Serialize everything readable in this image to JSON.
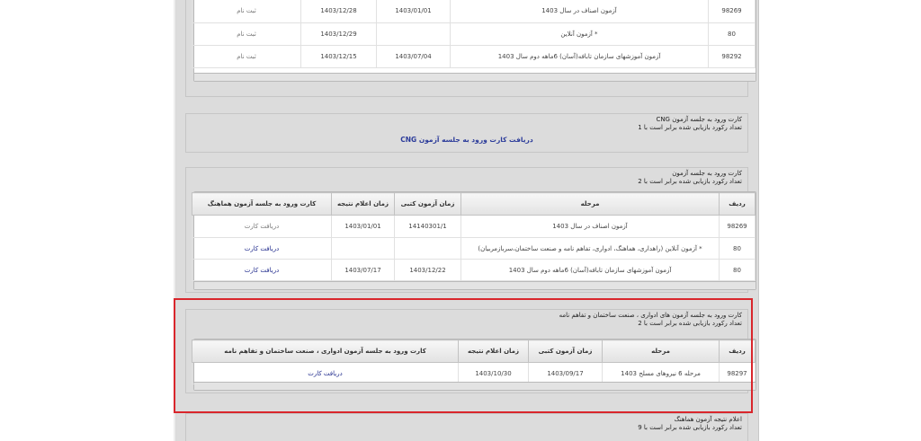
{
  "top_table": {
    "rows": [
      {
        "id": "98269",
        "stage": "آزمون اصناف در سال 1403",
        "exam": "1403/01/01",
        "result": "1403/12/28",
        "card": "ثبت نام"
      },
      {
        "id": "80",
        "stage": "* آزمون آنلاین",
        "exam": "",
        "result": "1403/12/29",
        "card": "ثبت نام"
      },
      {
        "id": "98292",
        "stage": "آزمون آموزشهای سازمان تابافه(آسان) 6ماهه دوم سال 1403",
        "exam": "1403/07/04",
        "result": "1403/12/15",
        "card": "ثبت نام"
      }
    ]
  },
  "cng": {
    "title": "کارت ورود به جلسه آزمون CNG",
    "count": "تعداد رکورد بازیابی شده برابر است با 1",
    "link": "دریافت کارت ورود به جلسه آزمون CNG"
  },
  "hamahang": {
    "title": "کارت ورود به جلسه آزمون",
    "count": "تعداد رکورد بازیابی شده برابر است با 2",
    "headers": {
      "id": "ردیف",
      "stage": "مرحله",
      "exam": "زمان آزمون کتبی",
      "result": "زمان اعلام نتیجه",
      "card": "کارت ورود به جلسه آزمون هماهنگ"
    },
    "rows": [
      {
        "id": "98269",
        "stage": "آزمون اصناف در سال 1403",
        "exam": "14140301/1",
        "result": "1403/01/01",
        "card": "دریافت کارت"
      },
      {
        "id": "80",
        "stage": "* آزمون آنلاین (راهداری، هماهنگ، ادواری، تفاهم نامه و صنعت ساختمان،سربازمربیان)",
        "exam": "",
        "result": "",
        "card": "دریافت کارت"
      },
      {
        "id": "80",
        "stage": "آزمون آموزشهای سازمان تابافه(آسان) 6ماهه دوم سال 1403",
        "exam": "1403/12/22",
        "result": "1403/07/17",
        "card": "دریافت کارت"
      }
    ]
  },
  "edvari": {
    "title": "کارت ورود به جلسه آزمون های ادواری ، صنعت ساختمان و تفاهم نامه",
    "count": "تعداد رکورد بازیابی شده برابر است با 2",
    "headers": {
      "id": "ردیف",
      "stage": "مرحله",
      "exam": "زمان آزمون کتبی",
      "result": "زمان اعلام نتیجه",
      "card": "کارت ورود به جلسه آزمون ادواری ، صنعت ساختمان و تفاهم نامه"
    },
    "rows": [
      {
        "id": "98297",
        "stage": "مرحله 6 نیروهای مسلح 1403",
        "exam": "1403/09/17",
        "result": "1403/10/30",
        "card": "دریافت کارت"
      }
    ]
  },
  "results": {
    "title": "اعلام نتیجه آزمون هماهنگ",
    "count": "تعداد رکورد بازیابی شده برابر است با 9"
  },
  "colors": {
    "highlight": "#d9262c",
    "link": "#1f2a8c",
    "page_bg": "#dcdcdc"
  }
}
